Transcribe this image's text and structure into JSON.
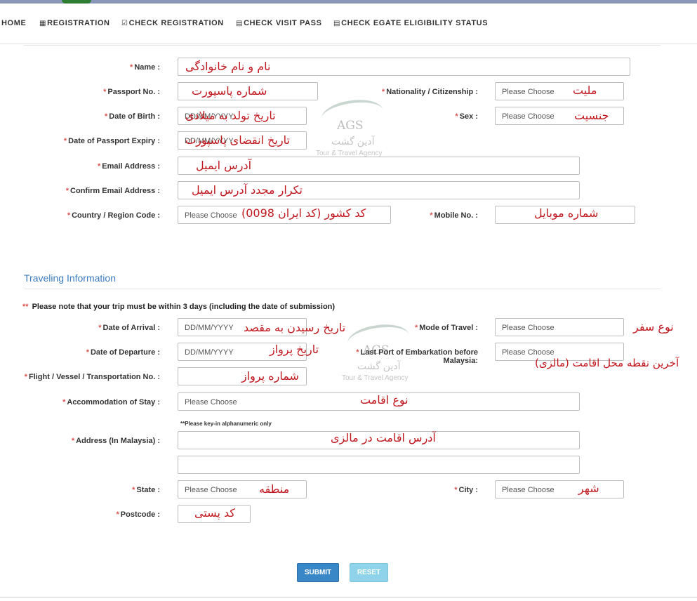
{
  "nav": {
    "items": [
      {
        "icon": "",
        "label": "HOME"
      },
      {
        "icon": "list-icon",
        "label": "REGISTRATION"
      },
      {
        "icon": "check-square-icon",
        "label": "CHECK REGISTRATION"
      },
      {
        "icon": "document-icon",
        "label": "CHECK VISIT PASS"
      },
      {
        "icon": "document-icon",
        "label": "CHECK EGATE ELIGIBILITY STATUS"
      }
    ]
  },
  "form": {
    "required_mark": "*",
    "name_label": "Name :",
    "passport_no_label": "Passport No. :",
    "nationality_label": "Nationality / Citizenship :",
    "nationality_placeholder": "Please Choose",
    "dob_label": "Date of Birth :",
    "dob_placeholder": "DD/MM/YYYY",
    "sex_label": "Sex :",
    "sex_placeholder": "Please Choose",
    "passport_expiry_label": "Date of Passport Expiry :",
    "passport_expiry_placeholder": "DD/MM/YYYY",
    "email_label": "Email Address :",
    "confirm_email_label": "Confirm Email Address :",
    "country_code_label": "Country / Region Code :",
    "country_code_placeholder": "Please Choose",
    "mobile_label": "Mobile No. :"
  },
  "travel": {
    "section_title": "Traveling Information",
    "note_mark": "**",
    "note": "Please note that your trip must be within 3 days (including the date of submission)",
    "arrival_label": "Date of Arrival :",
    "arrival_placeholder": "DD/MM/YYYY",
    "mode_label": "Mode of Travel :",
    "mode_placeholder": "Please Choose",
    "departure_label": "Date of Departure :",
    "departure_placeholder": "DD/MM/YYYY",
    "last_port_label_1": "Last Port of Embarkation before",
    "last_port_label_2": "Malaysia:",
    "last_port_placeholder": "Please Choose",
    "flight_label": "Flight / Vessel / Transportation No. :",
    "accommodation_label": "Accommodation of Stay :",
    "accommodation_placeholder": "Please Choose",
    "alnum_note": "**Please key-in alphanumeric only",
    "address_label": "Address (In Malaysia) :",
    "state_label": "State :",
    "state_placeholder": "Please Choose",
    "city_label": "City :",
    "city_placeholder": "Please Choose",
    "postcode_label": "Postcode :"
  },
  "buttons": {
    "submit": "SUBMIT",
    "reset": "RESET"
  },
  "annotations": {
    "name": "نام و نام خانوادگی",
    "passport": "شماره پاسپورت",
    "nationality": "ملیت",
    "dob": "تاریخ تولد به میلادی",
    "sex": "جنسیت",
    "expiry": "تاریخ انقضای پاسپورت",
    "email": "آدرس ایمیل",
    "confirm_email": "تکرار مجدد آدرس ایمیل",
    "country_code": "کد کشور (کد ایران 0098)",
    "mobile": "شماره موبایل",
    "arrival": "تاریخ رسیدن به مقصد",
    "mode": "نوع سفر",
    "departure": "تاریخ پرواز",
    "last_port": "آخرین نقطه محل اقامت (مالزی)",
    "flight": "شماره پرواز",
    "accommodation": "نوع اقامت",
    "address": "آدرس اقامت در مالزی",
    "state": "منطقه",
    "city": "شهر",
    "postcode": "کد پستی"
  },
  "watermark": {
    "brand": "AGS",
    "brand_fa": "آدین گشت",
    "tagline": "Tour & Travel Agency"
  }
}
